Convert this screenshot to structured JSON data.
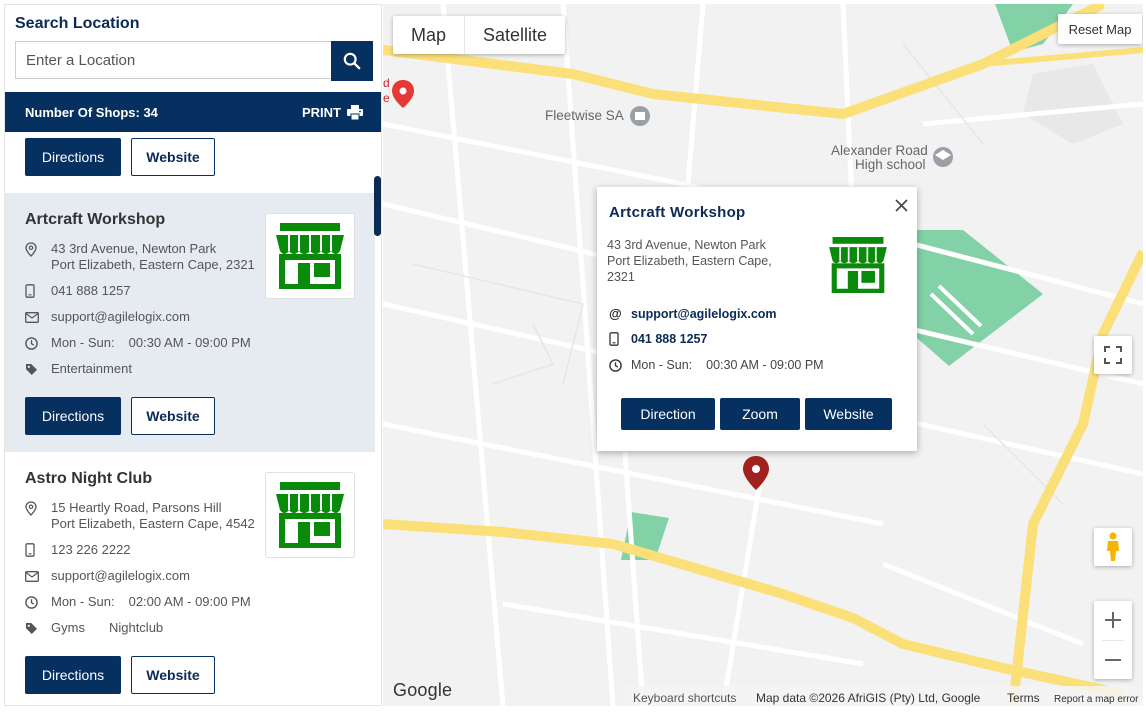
{
  "sidebar": {
    "search_title": "Search Location",
    "search_placeholder": "Enter a Location",
    "shops_count": "Number Of Shops: 34",
    "print_label": "PRINT",
    "top_buttons": {
      "directions": "Directions",
      "website": "Website"
    },
    "cards": [
      {
        "title": "Artcraft Workshop",
        "address_line1": "43 3rd Avenue, Newton Park",
        "address_line2": "Port Elizabeth, Eastern Cape, 2321",
        "phone": "041 888 1257",
        "email": "support@agilelogix.com",
        "hours_days": "Mon - Sun:",
        "hours_time": "00:30 AM - 09:00 PM",
        "categories": [
          "Entertainment"
        ],
        "directions": "Directions",
        "website": "Website"
      },
      {
        "title": "Astro Night Club",
        "address_line1": "15 Heartly Road, Parsons Hill",
        "address_line2": "Port Elizabeth, Eastern Cape, 4542",
        "phone": "123 226 2222",
        "email": "support@agilelogix.com",
        "hours_days": "Mon - Sun:",
        "hours_time": "02:00 AM - 09:00 PM",
        "categories": [
          "Gyms",
          "Nightclub"
        ],
        "directions": "Directions",
        "website": "Website"
      }
    ]
  },
  "map": {
    "type_map": "Map",
    "type_satellite": "Satellite",
    "reset": "Reset Map",
    "labels": {
      "fleetwise": "Fleetwise SA",
      "alexander_1": "Alexander Road",
      "alexander_2": "High school",
      "partial": "d",
      "partial2": "e"
    },
    "footer": {
      "google": "Google",
      "shortcuts": "Keyboard shortcuts",
      "mapdata": "Map data ©2026 AfriGIS (Pty) Ltd, Google",
      "terms": "Terms",
      "report": "Report a map error"
    },
    "colors": {
      "road": "#fbe07a",
      "park": "#82d1a7",
      "primary": "#06305f",
      "marker": "#a1211f",
      "store": "#0a8a0a"
    }
  },
  "popup": {
    "title": "Artcraft Workshop",
    "address_line1": "43 3rd Avenue, Newton Park",
    "address_line2": "Port Elizabeth, Eastern Cape,",
    "address_line3": "2321",
    "email": "support@agilelogix.com",
    "phone": "041 888 1257",
    "hours_days": "Mon - Sun:",
    "hours_time": "00:30 AM - 09:00 PM",
    "btn_direction": "Direction",
    "btn_zoom": "Zoom",
    "btn_website": "Website"
  }
}
